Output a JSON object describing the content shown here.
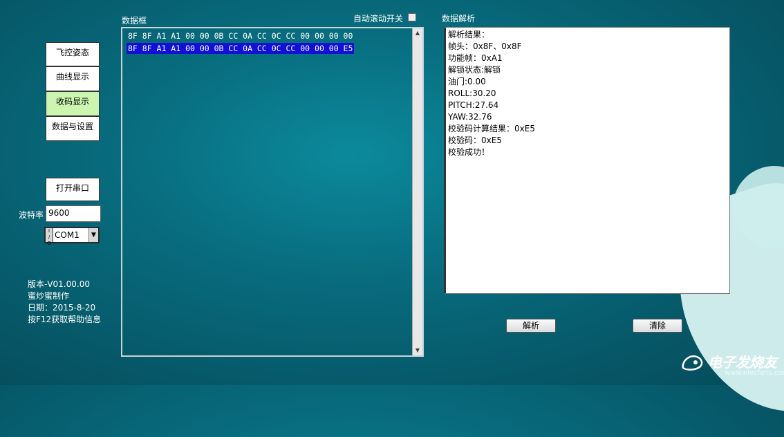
{
  "nav": {
    "items": [
      {
        "label": "飞控姿态",
        "active": false
      },
      {
        "label": "曲线显示",
        "active": false
      },
      {
        "label": "收码显示",
        "active": true
      },
      {
        "label": "数据与设置",
        "active": false
      }
    ]
  },
  "serial": {
    "open_label": "打开串口",
    "baud_label": "波特率",
    "baud_value": "9600",
    "port_io_label": "I/O",
    "port_value": "COM1"
  },
  "info": {
    "version": "版本-V01.00.00",
    "author": "蜜炒蜜制作",
    "date": "日期：2015-8-20",
    "help": "按F12获取帮助信息"
  },
  "hex_panel": {
    "title": "数据框",
    "auto_scroll_label": "自动滚动开关",
    "auto_scroll_checked": false,
    "lines": [
      {
        "text": "8F 8F A1 A1 00 00 0B CC 0A CC 0C CC 00 00 00 00",
        "selected": false
      },
      {
        "text": "8F 8F A1 A1 00 00 0B CC 0A CC 0C CC 00 00 00 E5",
        "selected": true
      }
    ]
  },
  "parse_panel": {
    "title": "数据解析",
    "lines": [
      "解析结果：",
      "帧头：0x8F、0x8F",
      "功能帧：0xA1",
      "解锁状态:解锁",
      "油门:0.00",
      "ROLL:30.20",
      "PITCH:27.64",
      "YAW:32.76",
      "校验码计算结果：0xE5",
      "校验码：0xE5",
      "校验成功！"
    ],
    "parse_button": "解析",
    "clear_button": "清除"
  },
  "watermark": {
    "title": "电子发烧友",
    "url": "www.elecfans.com"
  },
  "colors": {
    "selection": "#1010d8",
    "active_nav": "#ccf5b0",
    "background": "#076878"
  }
}
